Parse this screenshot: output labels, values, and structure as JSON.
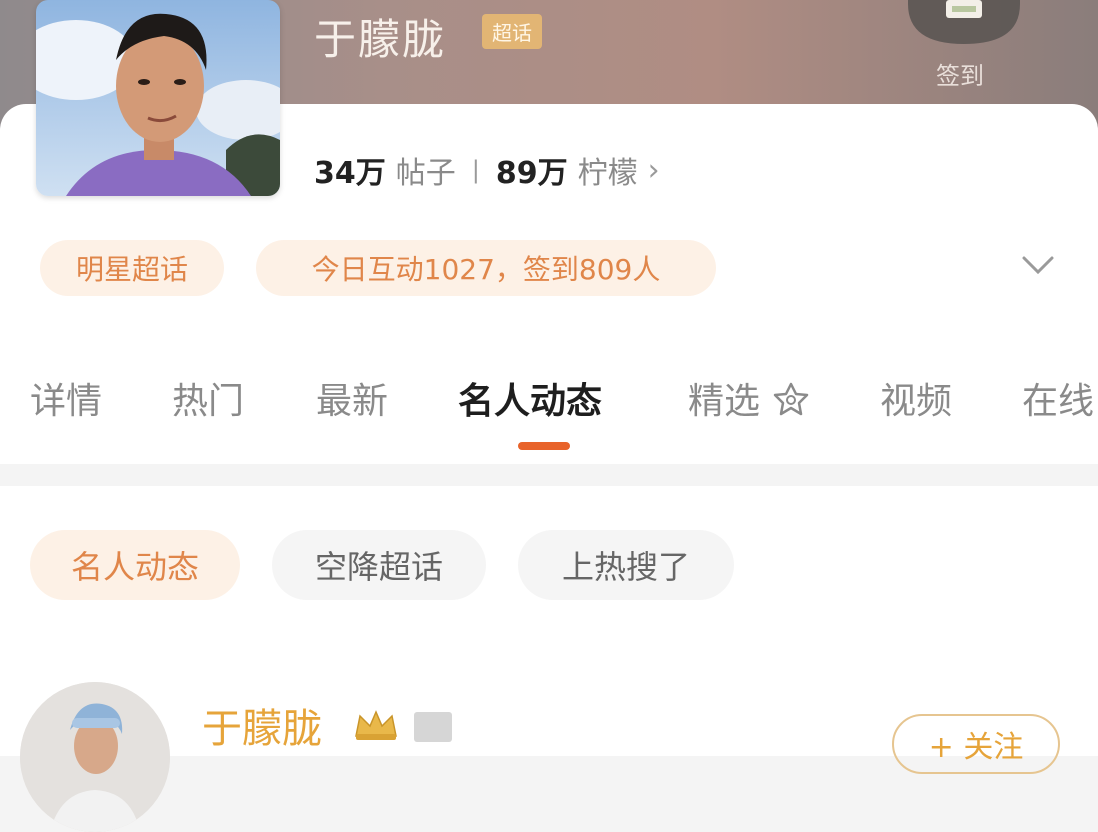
{
  "header": {
    "topic_name": "于朦胧",
    "super_tag": "超话",
    "checkin_label": "签到"
  },
  "stats": {
    "posts_count": "34万",
    "posts_label": "帖子",
    "fans_count": "89万",
    "fans_label": "柠檬",
    "chevron": "›"
  },
  "tags": {
    "category": "明星超话",
    "activity": "今日互动1027，签到809人"
  },
  "tabs": [
    {
      "label": "详情"
    },
    {
      "label": "热门"
    },
    {
      "label": "最新"
    },
    {
      "label": "名人动态"
    },
    {
      "label": "精选"
    },
    {
      "label": "视频"
    },
    {
      "label": "在线"
    }
  ],
  "active_tab": "名人动态",
  "subfilters": [
    {
      "label": "名人动态"
    },
    {
      "label": "空降超话"
    },
    {
      "label": "上热搜了"
    }
  ],
  "post": {
    "author": "于朦胧",
    "follow_label": "+ 关注"
  },
  "colors": {
    "accent": "#e8632a",
    "tag_text": "#e0864a",
    "name_gold": "#e6a43a"
  }
}
